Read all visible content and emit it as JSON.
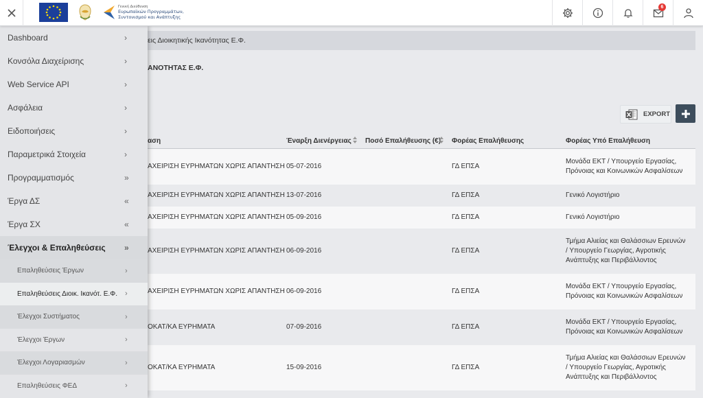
{
  "header": {
    "espa_logo_lines": [
      "Γενική Διεύθυνση",
      "Ευρωπαϊκών Προγραμμάτων,",
      "Συντονισμού και Ανάπτυξης"
    ],
    "notification_count": "6"
  },
  "breadcrumb": "εις Διοικητικής Ικανότητας Ε.Φ.",
  "page_title": "ΑΝΟΤΗΤΑΣ Ε.Φ.",
  "toolbar": {
    "export_label": "EXPORT"
  },
  "table": {
    "columns": [
      "αση",
      "Έναρξη Διενέργειας",
      "Ποσό Επαλήθευσης (€)",
      "Φορέας Επαλήθευσης",
      "Φορέας Υπό Επαλήθευση"
    ],
    "rows": [
      {
        "status": "ΑΧΕΙΡΙΣΗ ΕΥΡΗΜΑΤΩΝ ΧΩΡΙΣ ΑΠΑΝΤΗΣΗ",
        "start": "05-07-2016",
        "amount": "",
        "verifier": "ΓΔ ΕΠΣΑ",
        "verified": "Μονάδα ΕΚΤ / Υπουργείο Εργασίας, Πρόνοιας και Κοινωνικών Ασφαλίσεων"
      },
      {
        "status": "ΑΧΕΙΡΙΣΗ ΕΥΡΗΜΑΤΩΝ ΧΩΡΙΣ ΑΠΑΝΤΗΣΗ",
        "start": "13-07-2016",
        "amount": "",
        "verifier": "ΓΔ ΕΠΣΑ",
        "verified": "Γενικό Λογιστήριο"
      },
      {
        "status": "ΑΧΕΙΡΙΣΗ ΕΥΡΗΜΑΤΩΝ ΧΩΡΙΣ ΑΠΑΝΤΗΣΗ",
        "start": "05-09-2016",
        "amount": "",
        "verifier": "ΓΔ ΕΠΣΑ",
        "verified": "Γενικό Λογιστήριο"
      },
      {
        "status": "ΑΧΕΙΡΙΣΗ ΕΥΡΗΜΑΤΩΝ ΧΩΡΙΣ ΑΠΑΝΤΗΣΗ",
        "start": "06-09-2016",
        "amount": "",
        "verifier": "ΓΔ ΕΠΣΑ",
        "verified": "Τμήμα Αλιείας και Θαλάσσιων Ερευνών / Υπουργείο Γεωργίας, Αγροτικής Ανάπτυξης και Περιβάλλοντος"
      },
      {
        "status": "ΑΧΕΙΡΙΣΗ ΕΥΡΗΜΑΤΩΝ ΧΩΡΙΣ ΑΠΑΝΤΗΣΗ",
        "start": "06-09-2016",
        "amount": "",
        "verifier": "ΓΔ ΕΠΣΑ",
        "verified": "Μονάδα ΕΚΤ / Υπουργείο Εργασίας, Πρόνοιας και Κοινωνικών Ασφαλίσεων"
      },
      {
        "status": "ΟΚΑΤ/ΚΑ ΕΥΡΗΜΑΤΑ",
        "start": "07-09-2016",
        "amount": "",
        "verifier": "ΓΔ ΕΠΣΑ",
        "verified": "Μονάδα ΕΚΤ / Υπουργείο Εργασίας, Πρόνοιας και Κοινωνικών Ασφαλίσεων"
      },
      {
        "status": "ΟΚΑΤ/ΚΑ ΕΥΡΗΜΑΤΑ",
        "start": "15-09-2016",
        "amount": "",
        "verifier": "ΓΔ ΕΠΣΑ",
        "verified": "Τμήμα Αλιείας και Θαλάσσιων Ερευνών / Υπουργείο Γεωργίας, Αγροτικής Ανάπτυξης και Περιβάλλοντος"
      }
    ]
  },
  "sidebar": {
    "items": [
      {
        "label": "Dashboard",
        "chevron": "›"
      },
      {
        "label": "Κονσόλα Διαχείρισης",
        "chevron": "›"
      },
      {
        "label": "Web Service API",
        "chevron": "›"
      },
      {
        "label": "Ασφάλεια",
        "chevron": "›"
      },
      {
        "label": "Ειδοποιήσεις",
        "chevron": "›"
      },
      {
        "label": "Παραμετρικά Στοιχεία",
        "chevron": "›"
      },
      {
        "label": "Προγραμματισμός",
        "chevron": "»"
      },
      {
        "label": "Έργα ΔΣ",
        "chevron": "«"
      },
      {
        "label": "Έργα ΣΧ",
        "chevron": "«"
      },
      {
        "label": "Έλεγχοι & Επαληθεύσεις",
        "chevron": "»"
      }
    ],
    "sub_items": [
      {
        "label": "Επαληθεύσεις Έργων",
        "chevron": "›"
      },
      {
        "label": "Επαληθεύσεις Διοικ. Ικανότ. Ε.Φ.",
        "chevron": "›"
      },
      {
        "label": "Έλεγχοι Συστήματος",
        "chevron": "›"
      },
      {
        "label": "Έλεγχοι Έργων",
        "chevron": "›"
      },
      {
        "label": "Έλεγχοι Λογαριασμών",
        "chevron": "›"
      },
      {
        "label": "Επαληθεύσεις ΦΕΔ",
        "chevron": "›"
      }
    ]
  }
}
